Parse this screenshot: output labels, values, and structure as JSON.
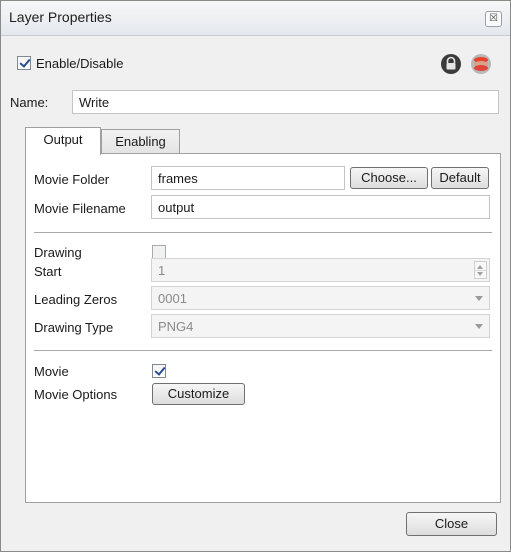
{
  "window": {
    "title": "Layer Properties",
    "close_glyph": "☒",
    "close_icon": "close-icon"
  },
  "header": {
    "enable_label": "Enable/Disable",
    "enable_checked": true,
    "lock_icon": "lock-icon",
    "layer_icon": "stack-icon"
  },
  "name": {
    "label": "Name:",
    "value": "Write"
  },
  "tabs": [
    {
      "label": "Output",
      "active": true
    },
    {
      "label": "Enabling",
      "active": false
    }
  ],
  "output": {
    "movie_folder": {
      "label": "Movie Folder",
      "value": "frames",
      "choose_label": "Choose...",
      "default_label": "Default"
    },
    "movie_filename": {
      "label": "Movie Filename",
      "value": "output"
    },
    "drawing": {
      "label": "Drawing",
      "checked": false
    },
    "start": {
      "label": "Start",
      "value": "1"
    },
    "leading_zeros": {
      "label": "Leading Zeros",
      "value": "0001"
    },
    "drawing_type": {
      "label": "Drawing Type",
      "value": "PNG4"
    },
    "movie": {
      "label": "Movie",
      "checked": true
    },
    "movie_options": {
      "label": "Movie Options",
      "button_label": "Customize"
    }
  },
  "footer": {
    "close_label": "Close"
  },
  "colors": {
    "window_bg": "#f0f0f0",
    "panel_bg": "#ffffff",
    "check_mark": "#2a4d8f",
    "disabled_text": "#8a8a8a"
  }
}
